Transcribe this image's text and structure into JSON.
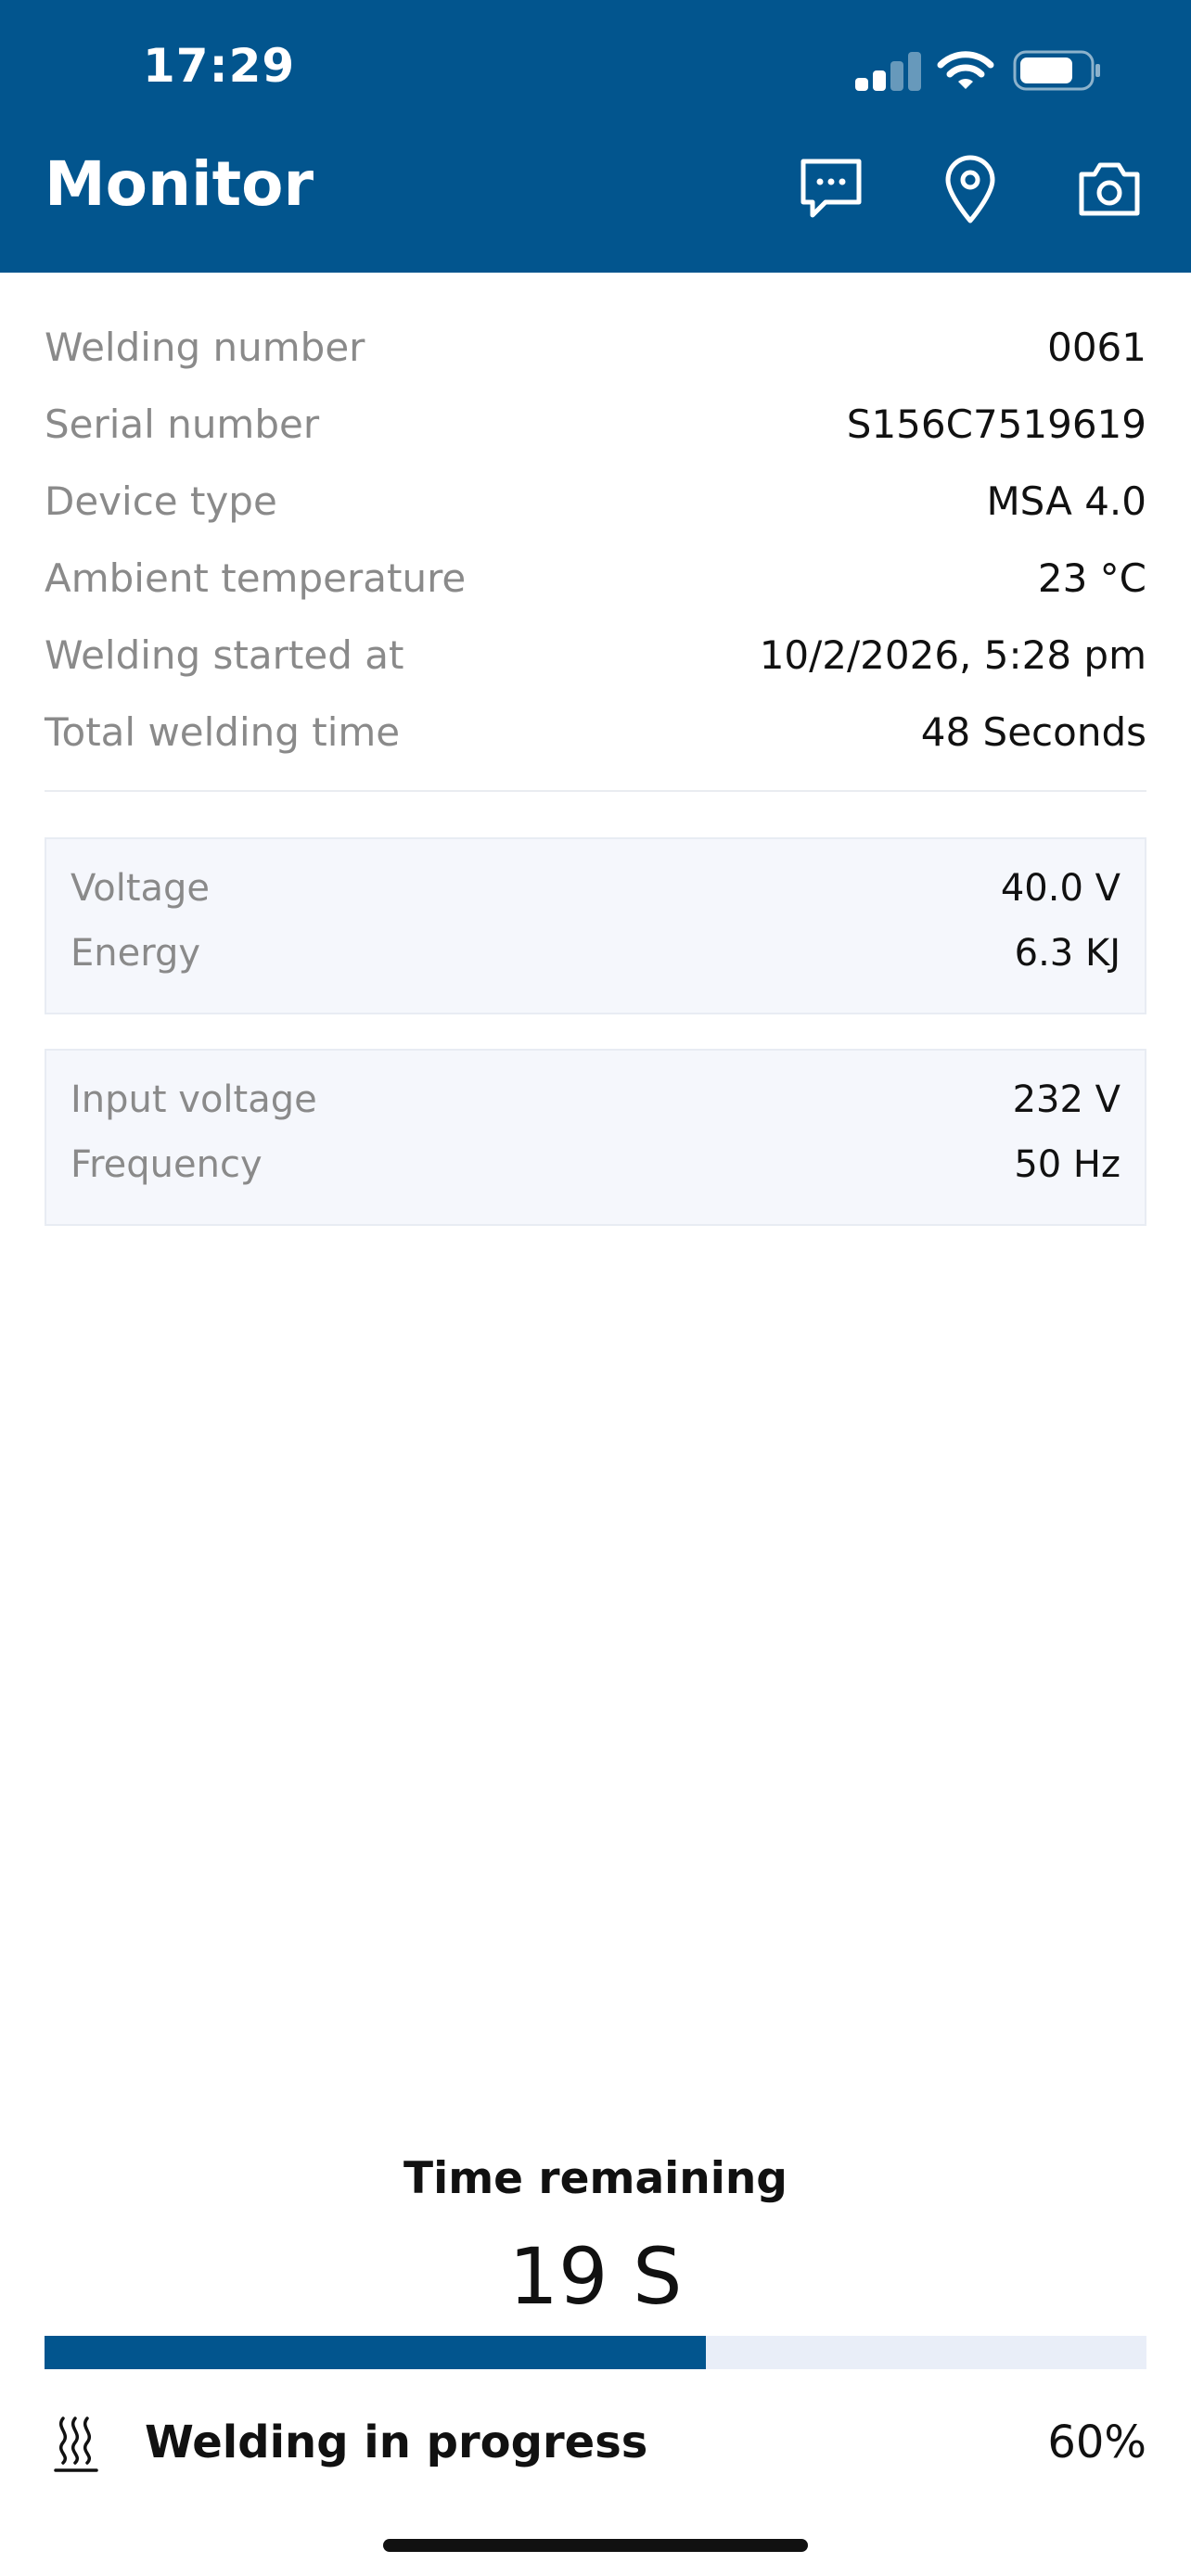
{
  "status_bar": {
    "time": "17:29",
    "signal_bars_active": 2,
    "signal_bars_total": 4,
    "battery_level": 0.75
  },
  "header": {
    "title": "Monitor",
    "icons": [
      "chat-icon",
      "location-pin-icon",
      "camera-icon"
    ],
    "background_color": "#02558e"
  },
  "details": [
    {
      "label": "Welding number",
      "value": "0061"
    },
    {
      "label": "Serial number",
      "value": "S156C7519619"
    },
    {
      "label": "Device type",
      "value": "MSA 4.0"
    },
    {
      "label": "Ambient temperature",
      "value": "23 °C"
    },
    {
      "label": "Welding started at",
      "value": "10/2/2026, 5:28 pm"
    },
    {
      "label": "Total welding time",
      "value": "48 Seconds"
    }
  ],
  "output_card": {
    "rows": [
      {
        "label": "Voltage",
        "value": "40.0 V"
      },
      {
        "label": "Energy",
        "value": "6.3 KJ"
      }
    ]
  },
  "input_card": {
    "rows": [
      {
        "label": "Input voltage",
        "value": "232 V"
      },
      {
        "label": "Frequency",
        "value": "50 Hz"
      }
    ]
  },
  "progress": {
    "time_label": "Time remaining",
    "time_value": "19 S",
    "fraction": 0.6,
    "status_icon": "heat-waves-icon",
    "status_text": "Welding in progress",
    "percent_text": "60%",
    "fill_color": "#02558e",
    "track_color": "#e9eef8"
  }
}
